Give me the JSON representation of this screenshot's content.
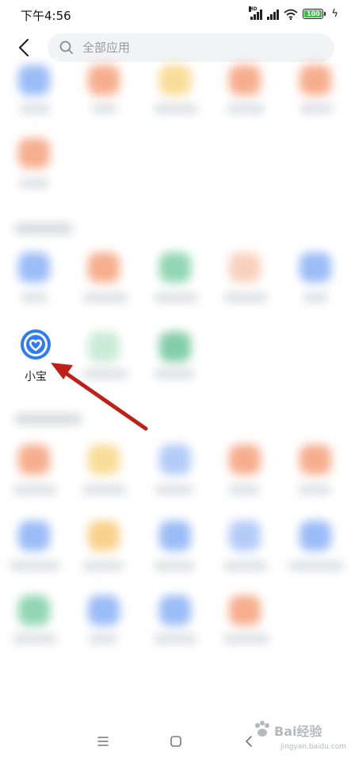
{
  "status_bar": {
    "time": "下午4:56",
    "battery_level": "100",
    "network_label": "HD"
  },
  "search": {
    "placeholder": "全部应用"
  },
  "visible_app": {
    "label": "小宝",
    "icon": "heart-ring-icon",
    "icon_color": "#2f7bf5"
  },
  "annotation": {
    "arrow_color": "#c0201a"
  },
  "watermark": {
    "brand": "Bai",
    "brand2": "经验",
    "url": "jingyan.baidu.com"
  },
  "colors": {
    "blue": "#8ab0f6",
    "orange": "#f5a07a",
    "yellow": "#f8d685",
    "green": "#7fcfa6",
    "peach": "#f7c9b3",
    "lightgreen": "#bfe8cf"
  }
}
